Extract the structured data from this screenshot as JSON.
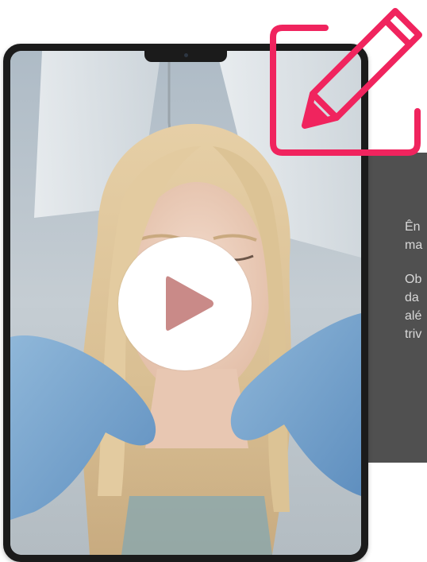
{
  "colors": {
    "accent": "#f0245e",
    "panel_background": "#505050",
    "panel_text": "#d8d8d8",
    "device_frame": "#1b1b1b",
    "play_button": "#ffffff",
    "play_icon": "#c98a88"
  },
  "icons": {
    "edit": "pencil-icon",
    "play": "play-icon"
  },
  "text_panel": {
    "paragraph_1": {
      "line_1": "Ên",
      "line_2": "ma"
    },
    "paragraph_2": {
      "line_1": "Ob",
      "line_2": "da",
      "line_3": "alé",
      "line_4": "triv"
    }
  }
}
